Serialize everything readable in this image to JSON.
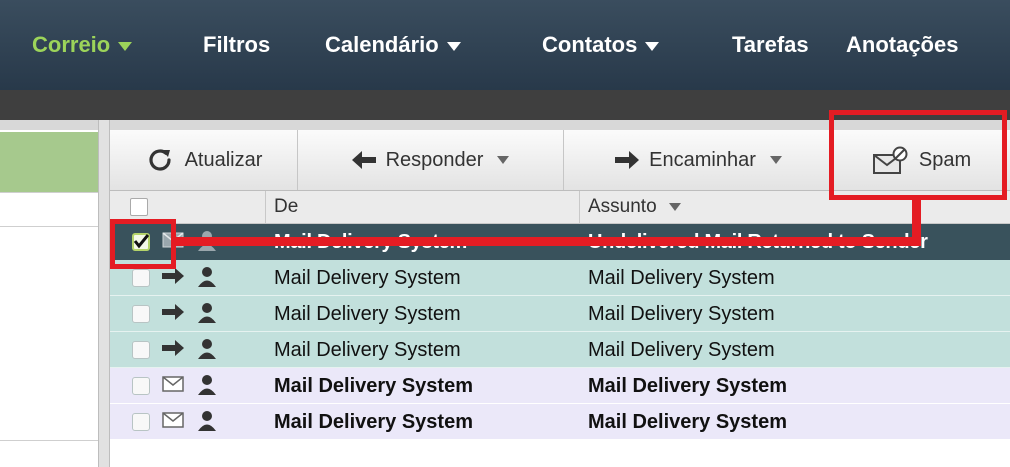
{
  "nav": {
    "items": [
      {
        "label": "Correio",
        "dropdown": true,
        "active": true
      },
      {
        "label": "Filtros",
        "dropdown": false
      },
      {
        "label": "Calendário",
        "dropdown": true
      },
      {
        "label": "Contatos",
        "dropdown": true
      },
      {
        "label": "Tarefas",
        "dropdown": false
      },
      {
        "label": "Anotações",
        "dropdown": false
      }
    ]
  },
  "toolbar": {
    "refresh_label": "Atualizar",
    "reply_label": "Responder",
    "forward_label": "Encaminhar",
    "spam_label": "Spam"
  },
  "table": {
    "columns": [
      "De",
      "Assunto"
    ],
    "rows": [
      {
        "from": "Mail Delivery System",
        "subject": "Undelivered Mail Returned to Sender",
        "state": "selected",
        "checked": true,
        "icon": "mail-icon"
      },
      {
        "from": "Mail Delivery System",
        "subject": "Mail Delivery System",
        "state": "read",
        "checked": false,
        "icon": "forwarded-icon"
      },
      {
        "from": "Mail Delivery System",
        "subject": "Mail Delivery System",
        "state": "read",
        "checked": false,
        "icon": "forwarded-icon"
      },
      {
        "from": "Mail Delivery System",
        "subject": "Mail Delivery System",
        "state": "read",
        "checked": false,
        "icon": "forwarded-icon"
      },
      {
        "from": "Mail Delivery System",
        "subject": "Mail Delivery System",
        "state": "unread",
        "checked": false,
        "icon": "mail-icon"
      },
      {
        "from": "Mail Delivery System",
        "subject": "Mail Delivery System",
        "state": "unread",
        "checked": false,
        "icon": "mail-icon"
      }
    ]
  },
  "colors": {
    "nav_bg": "#2e4052",
    "nav_active": "#9cd45a",
    "highlight": "#e41c23",
    "selected_row": "#39525c",
    "read_row": "#c2e0dc",
    "unread_row": "#ebe8f9"
  }
}
